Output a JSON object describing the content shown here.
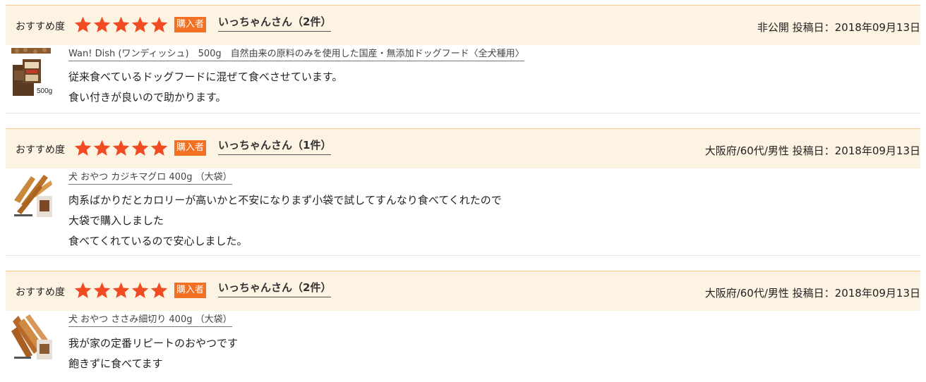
{
  "labels": {
    "recommend": "おすすめ度",
    "buyer_badge": "購入者"
  },
  "colors": {
    "header_bg": "#fdf3e3",
    "header_border": "#f3cc8a",
    "star": "#f04b23",
    "buyer_badge": "#f36f21"
  },
  "reviews": [
    {
      "rating": 5,
      "reviewer": "いっちゃんさん（2件）",
      "meta": "非公開 投稿日：2018年09月13日",
      "product": "Wan! Dish (ワンディッシュ)　500g　自然由来の原料のみを使用した国産・無添加ドッグフード〈全犬種用〉",
      "thumb_label": "500g",
      "body": [
        "従来食べているドッグフードに混ぜて食べさせています。",
        "食い付きが良いので助かります。"
      ]
    },
    {
      "rating": 5,
      "reviewer": "いっちゃんさん（1件）",
      "meta": "大阪府/60代/男性 投稿日：2018年09月13日",
      "product": "犬 おやつ カジキマグロ 400g （大袋）",
      "thumb_label": "",
      "body": [
        "肉系ばかりだとカロリーが高いかと不安になりまず小袋で試してすんなり食べてくれたので",
        "大袋で購入しました",
        "食べてくれているので安心しました。"
      ]
    },
    {
      "rating": 5,
      "reviewer": "いっちゃんさん（2件）",
      "meta": "大阪府/60代/男性 投稿日：2018年09月13日",
      "product": "犬 おやつ ささみ細切り 400g （大袋）",
      "thumb_label": "",
      "body": [
        "我が家の定番リピートのおやつです",
        "飽きずに食べてます"
      ]
    }
  ]
}
